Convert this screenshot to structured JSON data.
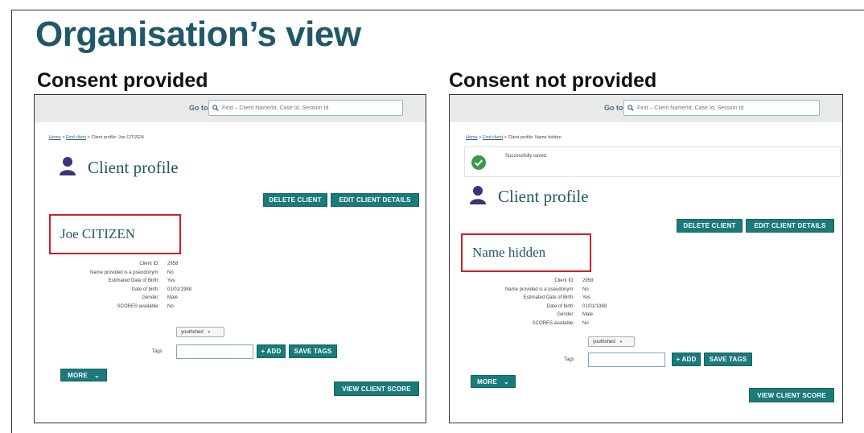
{
  "slide": {
    "title": "Organisation’s view"
  },
  "left": {
    "heading": "Consent provided",
    "goto_label": "Go to",
    "search_placeholder": "Find – Client Name/Id, Case Id, Session Id",
    "breadcrumb": {
      "home": "Home",
      "sep1": " > ",
      "find_client": "Find client",
      "sep2": " > ",
      "current": "Client profile: Joe CITIZEN"
    },
    "profile_title": "Client profile",
    "delete_label": "DELETE CLIENT",
    "edit_label": "EDIT CLIENT DETAILS",
    "client_name": "Joe CITIZEN",
    "details": [
      {
        "label": "Client ID:",
        "value": "2958"
      },
      {
        "label": "Name provided is a pseudonym:",
        "value": "No"
      },
      {
        "label": "Estimated Date of Birth:",
        "value": "Yes"
      },
      {
        "label": "Date of birth:",
        "value": "01/01/1988"
      },
      {
        "label": "Gender:",
        "value": "Male"
      },
      {
        "label": "SCORES available:",
        "value": "No"
      }
    ],
    "tag_select": "youthshed",
    "tags_label": "Tags",
    "add_label": "+ ADD",
    "save_tags_label": "SAVE TAGS",
    "more_label": "MORE",
    "score_label": "VIEW CLIENT SCORE"
  },
  "right": {
    "heading": "Consent not provided",
    "goto_label": "Go to",
    "search_placeholder": "Find – Client Name/Id, Case Id, Session Id",
    "breadcrumb": {
      "home": "Home",
      "sep1": " > ",
      "find_client": "Find client",
      "sep2": " > ",
      "current": "Client profile: Name hidden"
    },
    "success_message": "Successfully saved",
    "profile_title": "Client profile",
    "delete_label": "DELETE CLIENT",
    "edit_label": "EDIT CLIENT DETAILS",
    "client_name": "Name hidden",
    "details": [
      {
        "label": "Client ID:",
        "value": "2958"
      },
      {
        "label": "Name provided is a pseudonym:",
        "value": "No"
      },
      {
        "label": "Estimated Date of Birth:",
        "value": "Yes"
      },
      {
        "label": "Date of birth:",
        "value": "01/01/1988"
      },
      {
        "label": "Gender:",
        "value": "Male"
      },
      {
        "label": "SCORES available:",
        "value": "No"
      }
    ],
    "tag_select": "youthshed",
    "tags_label": "Tags",
    "add_label": "+ ADD",
    "save_tags_label": "SAVE TAGS",
    "more_label": "MORE",
    "score_label": "VIEW CLIENT SCORE"
  },
  "colors": {
    "title": "#215868",
    "button": "#1c7a7a",
    "highlight": "#cc1f2d",
    "success": "#3a9a4a"
  },
  "icons": [
    "search-icon",
    "user-icon",
    "check-circle-icon",
    "chevron-down-icon"
  ]
}
